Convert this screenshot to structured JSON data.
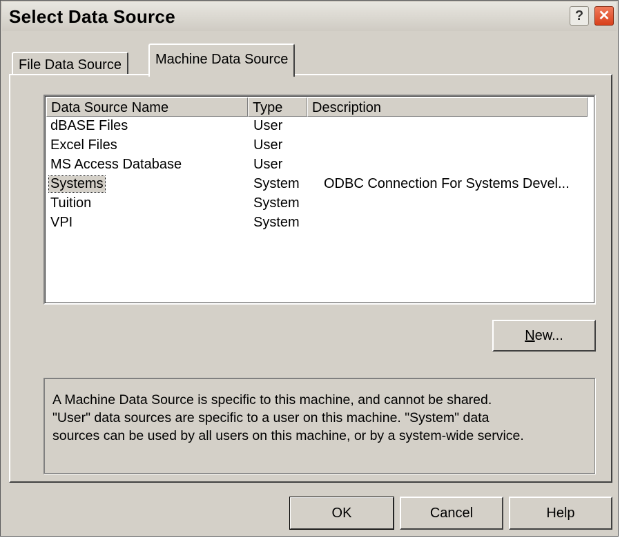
{
  "window": {
    "title": "Select Data Source",
    "help_glyph": "?",
    "close_glyph": "✕"
  },
  "tabs": [
    {
      "label": "File Data Source",
      "selected": false
    },
    {
      "label": "Machine Data Source",
      "selected": true
    }
  ],
  "list": {
    "columns": [
      "Data Source Name",
      "Type",
      "Description"
    ],
    "rows": [
      {
        "name": "dBASE Files",
        "type": "User",
        "description": ""
      },
      {
        "name": "Excel Files",
        "type": "User",
        "description": ""
      },
      {
        "name": "MS Access Database",
        "type": "User",
        "description": ""
      },
      {
        "name": "Systems",
        "type": "System",
        "description": "ODBC Connection For Systems Devel...",
        "selected": true
      },
      {
        "name": "Tuition",
        "type": "System",
        "description": ""
      },
      {
        "name": "VPI",
        "type": "System",
        "description": ""
      }
    ]
  },
  "new_button": {
    "mnemonic": "N",
    "rest": "ew..."
  },
  "explanation": {
    "lines": [
      "A Machine Data Source is specific to this machine, and cannot be shared.",
      "\"User\" data sources are specific to a user on this machine.  \"System\" data",
      "sources can be used by all users on this machine, or by a system-wide service."
    ]
  },
  "buttons": {
    "ok": "OK",
    "cancel": "Cancel",
    "help": "Help"
  },
  "colors": {
    "dialog_face": "#d4d0c8",
    "list_background": "#ffffff",
    "close_button": "#d8401c"
  }
}
